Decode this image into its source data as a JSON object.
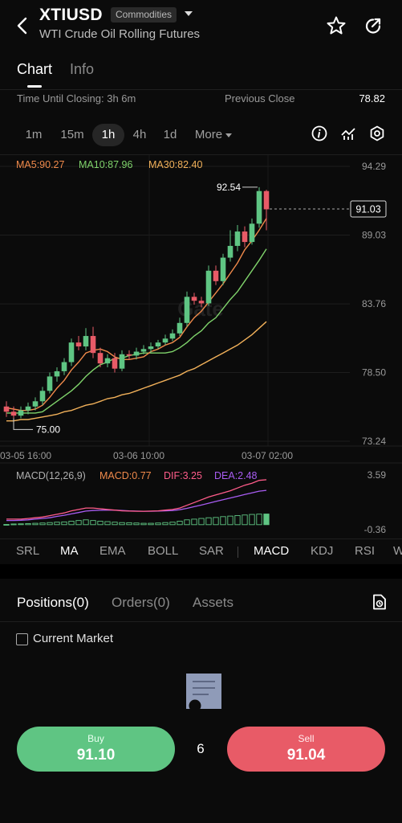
{
  "header": {
    "symbol": "XTIUSD",
    "tag": "Commodities",
    "subtitle": "WTI Crude Oil Rolling Futures",
    "icons": [
      "back-arrow-icon",
      "caret-down-icon",
      "star-icon",
      "share-icon"
    ]
  },
  "tabs": [
    {
      "label": "Chart",
      "active": true
    },
    {
      "label": "Info",
      "active": false
    }
  ],
  "closing": {
    "time_label": "Time Until Closing: 3h 6m",
    "prev_label": "Previous Close",
    "prev_value": "78.82"
  },
  "intervals": [
    {
      "label": "1m"
    },
    {
      "label": "15m"
    },
    {
      "label": "1h",
      "active": true
    },
    {
      "label": "4h"
    },
    {
      "label": "1d"
    },
    {
      "label": "More"
    }
  ],
  "tools": [
    "info-icon",
    "indicator-icon",
    "settings-icon"
  ],
  "chart": {
    "ma_legend": {
      "ma5": "MA5:90.27",
      "ma10": "MA10:87.96",
      "ma30": "MA30:82.40"
    },
    "y_ticks": [
      "94.29",
      "89.03",
      "83.76",
      "78.50",
      "73.24"
    ],
    "x_ticks": [
      "03-05 16:00",
      "03-06 10:00",
      "03-07 02:00"
    ],
    "high_label": "92.54",
    "low_label": "75.00",
    "last_price": "91.03",
    "watermark": "Gate",
    "macd_legend": {
      "params": "MACD(12,26,9)",
      "macd": "MACD:0.77",
      "dif": "DIF:3.25",
      "dea": "DEA:2.48"
    },
    "macd_ticks": [
      "3.59",
      "-0.36"
    ],
    "colors": {
      "up": "#5fc583",
      "down": "#e85b67",
      "ma5": "#f08a4b",
      "ma10": "#7fd36b",
      "ma30": "#f2b15a",
      "dif": "#ff5c8a",
      "dea": "#a85cf2"
    }
  },
  "chart_data": {
    "type": "candlestick",
    "ylim": [
      73.24,
      94.29
    ],
    "candles": [
      [
        75.9,
        75.5,
        76.3,
        75.1
      ],
      [
        75.5,
        75.2,
        75.9,
        75.0
      ],
      [
        75.2,
        75.6,
        75.9,
        75.0
      ],
      [
        75.6,
        75.9,
        76.2,
        75.3
      ],
      [
        75.9,
        76.3,
        76.6,
        75.6
      ],
      [
        76.3,
        77.1,
        77.4,
        76.0
      ],
      [
        77.1,
        78.2,
        78.5,
        76.9
      ],
      [
        78.2,
        78.6,
        78.9,
        77.8
      ],
      [
        78.6,
        79.3,
        79.6,
        78.3
      ],
      [
        79.3,
        80.8,
        81.1,
        79.0
      ],
      [
        80.8,
        80.5,
        81.3,
        80.2
      ],
      [
        80.5,
        81.3,
        81.9,
        80.2
      ],
      [
        81.3,
        80.0,
        82.0,
        79.6
      ],
      [
        80.0,
        79.2,
        80.4,
        78.9
      ],
      [
        79.2,
        79.6,
        79.9,
        78.9
      ],
      [
        79.6,
        78.8,
        80.0,
        78.5
      ],
      [
        78.8,
        79.9,
        80.2,
        78.6
      ],
      [
        79.9,
        79.8,
        80.2,
        79.5
      ],
      [
        79.8,
        80.1,
        80.4,
        79.5
      ],
      [
        80.1,
        80.3,
        80.6,
        79.9
      ],
      [
        80.3,
        80.5,
        80.8,
        80.0
      ],
      [
        80.5,
        80.8,
        81.0,
        80.3
      ],
      [
        80.8,
        81.1,
        81.4,
        80.6
      ],
      [
        81.1,
        81.5,
        81.8,
        80.9
      ],
      [
        81.5,
        82.3,
        82.7,
        81.3
      ],
      [
        82.3,
        84.3,
        84.7,
        82.0
      ],
      [
        84.3,
        84.0,
        84.6,
        83.7
      ],
      [
        84.0,
        83.8,
        84.3,
        83.5
      ],
      [
        83.8,
        86.3,
        86.7,
        83.6
      ],
      [
        86.3,
        85.5,
        86.7,
        85.2
      ],
      [
        85.5,
        87.3,
        87.6,
        85.2
      ],
      [
        87.3,
        88.2,
        89.4,
        87.0
      ],
      [
        88.2,
        89.3,
        89.8,
        87.8
      ],
      [
        89.3,
        88.5,
        89.7,
        88.1
      ],
      [
        88.5,
        89.9,
        90.3,
        88.3
      ],
      [
        89.9,
        92.4,
        92.7,
        89.6
      ],
      [
        92.4,
        91.0,
        92.5,
        89.4
      ]
    ],
    "ma5": [
      75.8,
      75.7,
      75.6,
      75.6,
      75.7,
      76.0,
      76.6,
      77.3,
      77.9,
      78.7,
      79.3,
      80.0,
      80.2,
      80.3,
      80.1,
      79.7,
      79.5,
      79.5,
      79.6,
      79.7,
      80.1,
      80.3,
      80.6,
      80.8,
      81.2,
      82.0,
      82.7,
      83.2,
      83.9,
      84.6,
      85.3,
      86.1,
      86.9,
      87.9,
      88.6,
      89.4,
      90.3
    ],
    "ma10": [
      75.4,
      75.4,
      75.4,
      75.4,
      75.4,
      75.5,
      75.9,
      76.3,
      76.7,
      77.1,
      77.6,
      78.2,
      78.7,
      79.1,
      79.3,
      79.6,
      79.6,
      79.8,
      79.9,
      80.0,
      80.0,
      80.0,
      80.0,
      80.1,
      80.4,
      80.8,
      81.3,
      81.7,
      82.3,
      82.7,
      83.4,
      84.1,
      84.7,
      85.5,
      86.3,
      87.1,
      87.96
    ],
    "ma30": [
      74.8,
      74.8,
      74.9,
      74.9,
      75.0,
      75.1,
      75.2,
      75.3,
      75.5,
      75.6,
      75.8,
      76.0,
      76.1,
      76.3,
      76.5,
      76.6,
      76.8,
      76.9,
      77.1,
      77.3,
      77.5,
      77.7,
      77.9,
      78.1,
      78.3,
      78.6,
      78.8,
      79.1,
      79.4,
      79.7,
      80.0,
      80.3,
      80.6,
      81.0,
      81.4,
      81.9,
      82.4
    ],
    "macd_hist": [
      0.02,
      0.05,
      0.06,
      0.08,
      0.1,
      0.12,
      0.15,
      0.18,
      0.2,
      0.25,
      0.3,
      0.35,
      0.3,
      0.25,
      0.22,
      0.18,
      0.15,
      0.14,
      0.12,
      0.1,
      0.1,
      0.12,
      0.15,
      0.18,
      0.25,
      0.35,
      0.4,
      0.45,
      0.5,
      0.52,
      0.58,
      0.62,
      0.66,
      0.7,
      0.74,
      0.76,
      0.77
    ],
    "dif": [
      0.4,
      0.4,
      0.4,
      0.45,
      0.5,
      0.55,
      0.65,
      0.75,
      0.85,
      1.0,
      1.1,
      1.2,
      1.2,
      1.15,
      1.1,
      1.05,
      1.0,
      0.98,
      0.97,
      0.97,
      0.98,
      1.0,
      1.05,
      1.1,
      1.2,
      1.4,
      1.6,
      1.8,
      2.0,
      2.15,
      2.3,
      2.45,
      2.65,
      2.85,
      3.0,
      3.2,
      3.25
    ],
    "dea": [
      0.3,
      0.3,
      0.32,
      0.35,
      0.4,
      0.45,
      0.5,
      0.6,
      0.68,
      0.78,
      0.88,
      0.98,
      1.02,
      1.04,
      1.05,
      1.05,
      1.03,
      1.0,
      0.98,
      0.97,
      0.97,
      0.98,
      1.0,
      1.02,
      1.08,
      1.18,
      1.3,
      1.42,
      1.55,
      1.68,
      1.8,
      1.93,
      2.05,
      2.18,
      2.3,
      2.42,
      2.48
    ]
  },
  "indicators": [
    {
      "label": "SRL"
    },
    {
      "label": "MA",
      "active": true
    },
    {
      "label": "EMA"
    },
    {
      "label": "BOLL"
    },
    {
      "label": "SAR"
    },
    {
      "label": "MACD",
      "active": true
    },
    {
      "label": "KDJ"
    },
    {
      "label": "RSI"
    },
    {
      "label": "W"
    }
  ],
  "positions": {
    "tabs": [
      {
        "label": "Positions(0)",
        "active": true
      },
      {
        "label": "Orders(0)"
      },
      {
        "label": "Assets"
      }
    ],
    "current_market": "Current Market"
  },
  "trade": {
    "buy_label": "Buy",
    "buy_price": "91.10",
    "spread": "6",
    "sell_label": "Sell",
    "sell_price": "91.04"
  }
}
